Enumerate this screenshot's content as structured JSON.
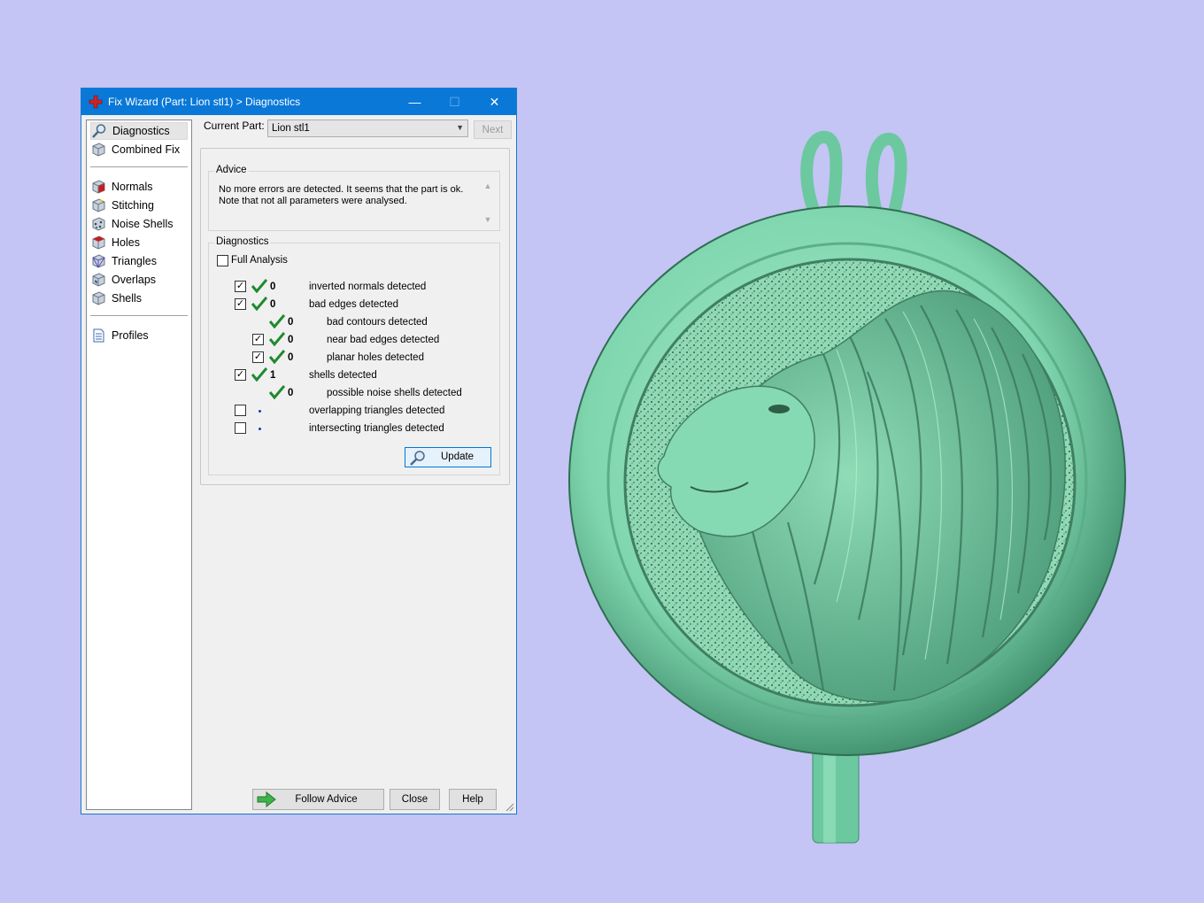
{
  "window": {
    "title": "Fix Wizard (Part: Lion stl1) > Diagnostics",
    "minimize": "—",
    "maximize": "☐",
    "close": "✕"
  },
  "nav": {
    "items": [
      {
        "label": "Diagnostics",
        "icon": "magnifier-icon"
      },
      {
        "label": "Combined Fix",
        "icon": "cube-icon"
      },
      {
        "label": "Normals",
        "icon": "normals-cube-icon"
      },
      {
        "label": "Stitching",
        "icon": "stitching-cube-icon"
      },
      {
        "label": "Noise Shells",
        "icon": "noise-shells-icon"
      },
      {
        "label": "Holes",
        "icon": "holes-cube-icon"
      },
      {
        "label": "Triangles",
        "icon": "triangles-cube-icon"
      },
      {
        "label": "Overlaps",
        "icon": "overlaps-cube-icon"
      },
      {
        "label": "Shells",
        "icon": "shells-cube-icon"
      },
      {
        "label": "Profiles",
        "icon": "document-icon"
      }
    ]
  },
  "current_part": {
    "label": "Current Part:",
    "value": "Lion stl1",
    "next_label": "Next"
  },
  "advice": {
    "legend": "Advice",
    "text_line1": "No more errors are detected. It seems that the part is ok.",
    "text_line2": "Note that not all parameters were analysed."
  },
  "diagnostics": {
    "legend": "Diagnostics",
    "full_analysis_label": "Full Analysis",
    "rows": [
      {
        "count": "0",
        "label": "inverted normals detected",
        "checked": true,
        "ok": true
      },
      {
        "count": "0",
        "label": "bad edges detected",
        "checked": true,
        "ok": true
      },
      {
        "count": "0",
        "label": "bad contours detected",
        "ok": true
      },
      {
        "count": "0",
        "label": "near bad edges detected",
        "checked": true,
        "ok": true
      },
      {
        "count": "0",
        "label": "planar holes detected",
        "checked": true,
        "ok": true
      },
      {
        "count": "1",
        "label": "shells detected",
        "checked": true,
        "ok": true
      },
      {
        "count": "0",
        "label": "possible noise shells detected",
        "ok": true
      },
      {
        "count": "",
        "label": "overlapping triangles detected",
        "checked": false
      },
      {
        "count": "",
        "label": "intersecting triangles detected",
        "checked": false
      }
    ],
    "update_label": "Update"
  },
  "footer": {
    "follow_label": "Follow Advice",
    "close_label": "Close",
    "help_label": "Help"
  },
  "colors": {
    "background": "#c4c4f5",
    "titlebar": "#0a78d7",
    "model": "#7fd6ae",
    "check_green": "#1e8a2e"
  }
}
